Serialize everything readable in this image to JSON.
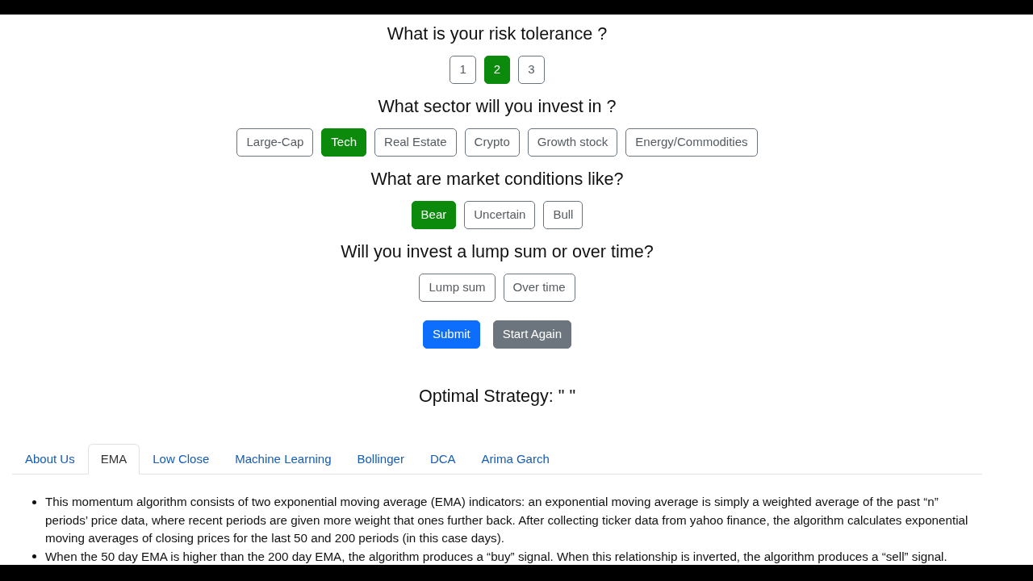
{
  "questions": [
    {
      "title": "What is your risk tolerance ?",
      "options": [
        {
          "label": "1",
          "selected": false
        },
        {
          "label": "2",
          "selected": true
        },
        {
          "label": "3",
          "selected": false
        }
      ]
    },
    {
      "title": "What sector will you invest in ?",
      "options": [
        {
          "label": "Large-Cap",
          "selected": false
        },
        {
          "label": "Tech",
          "selected": true
        },
        {
          "label": "Real Estate",
          "selected": false
        },
        {
          "label": "Crypto",
          "selected": false
        },
        {
          "label": "Growth stock",
          "selected": false
        },
        {
          "label": "Energy/Commodities",
          "selected": false
        }
      ]
    },
    {
      "title": "What are market conditions like?",
      "options": [
        {
          "label": "Bear",
          "selected": true
        },
        {
          "label": "Uncertain",
          "selected": false
        },
        {
          "label": "Bull",
          "selected": false
        }
      ]
    },
    {
      "title": "Will you invest a lump sum or over time?",
      "options": [
        {
          "label": "Lump sum",
          "selected": false
        },
        {
          "label": "Over time",
          "selected": false
        }
      ]
    }
  ],
  "actions": [
    {
      "label": "Submit",
      "kind": "primary"
    },
    {
      "label": "Start Again",
      "kind": "secondary"
    }
  ],
  "result": {
    "text": "Optimal Strategy: \" \""
  },
  "tabs": [
    {
      "label": "About Us",
      "selected": false
    },
    {
      "label": "EMA",
      "selected": true
    },
    {
      "label": "Low Close",
      "selected": false
    },
    {
      "label": "Machine Learning",
      "selected": false
    },
    {
      "label": "Bollinger",
      "selected": false
    },
    {
      "label": "DCA",
      "selected": false
    },
    {
      "label": "Arima Garch",
      "selected": false
    }
  ],
  "content": {
    "bullets": [
      "This momentum algorithm consists of two exponential moving average (EMA) indicators: an exponential moving average is simply a weighted average of the past “n” periods’ price data, where recent periods are given more weight that ones further back. After collecting ticker data from yahoo finance, the algorithm calculates exponential moving averages of closing prices for the last 50 and 200 periods (in this case days).",
      "When the 50 day EMA is higher than the 200 day EMA, the algorithm produces a “buy” signal. When this relationship is inverted, the algorithm produces a “sell” signal."
    ]
  }
}
